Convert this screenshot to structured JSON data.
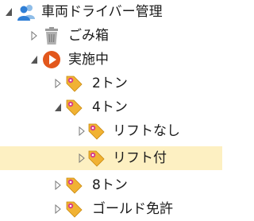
{
  "tree": {
    "root": {
      "label": "車両ドライバー管理",
      "icon": "users-icon",
      "expanded": true
    },
    "trash": {
      "label": "ごみ箱",
      "icon": "trash-icon",
      "expanded": false
    },
    "active": {
      "label": "実施中",
      "icon": "play-circle-icon",
      "expanded": true
    },
    "items": [
      {
        "label": "2トン",
        "icon": "tag-icon",
        "expanded": false
      },
      {
        "label": "4トン",
        "icon": "tag-icon",
        "expanded": true
      },
      {
        "label": "リフトなし",
        "icon": "tag-icon",
        "expanded": false
      },
      {
        "label": "リフト付",
        "icon": "tag-icon",
        "expanded": false,
        "selected": true
      },
      {
        "label": "8トン",
        "icon": "tag-icon",
        "expanded": false
      },
      {
        "label": "ゴールド免許",
        "icon": "tag-icon",
        "expanded": false
      }
    ]
  },
  "colors": {
    "selection": "#fdf0c2",
    "users_icon": "#2f7fd6",
    "play_icon": "#e2571c",
    "tag_icon": "#f1b233",
    "tag_dot": "#d63a8a",
    "trash_icon": "#8a8a8a",
    "twisty": "#555555"
  }
}
